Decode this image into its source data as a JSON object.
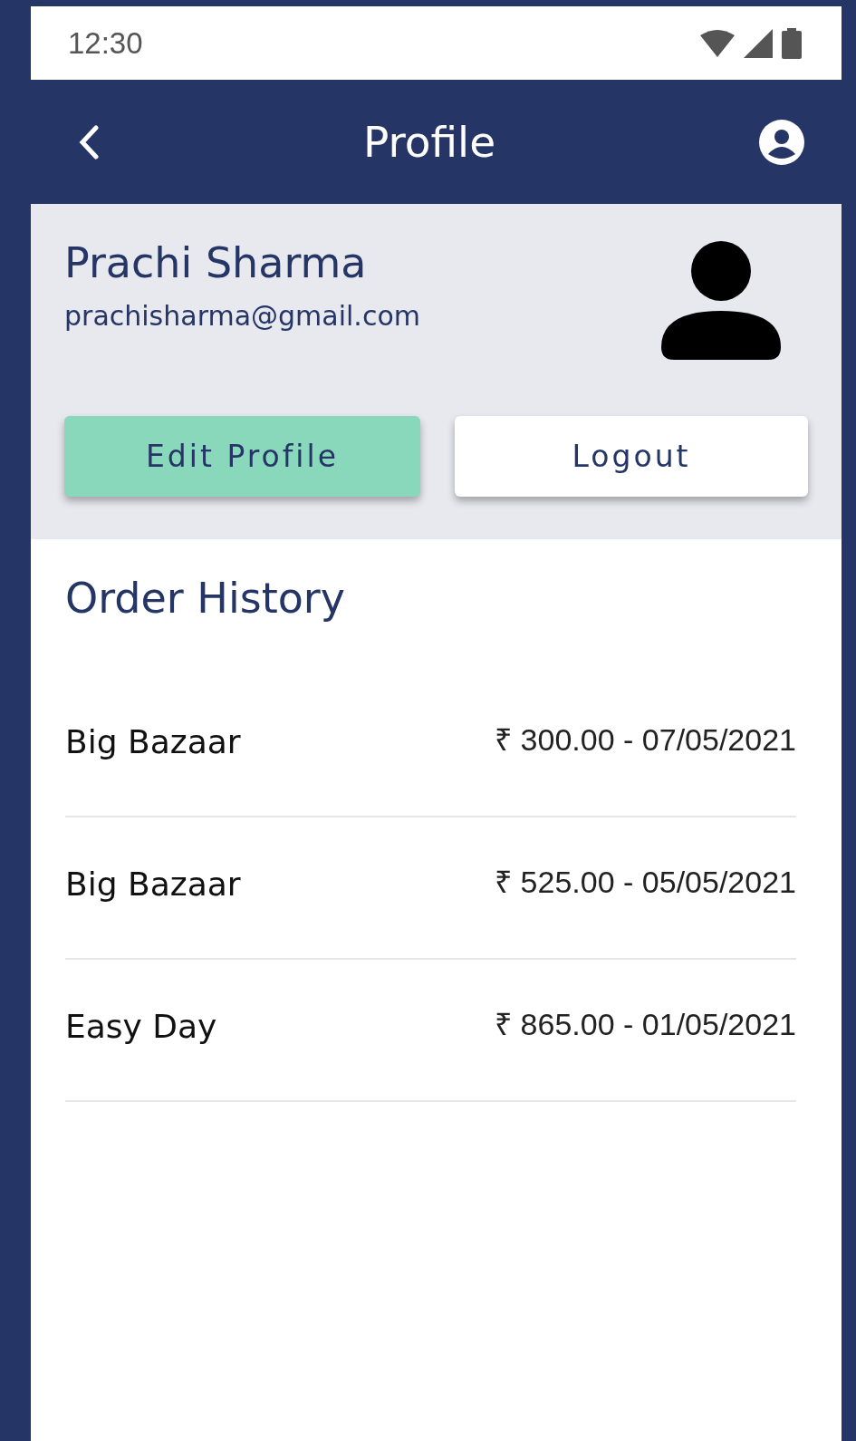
{
  "status_bar": {
    "time": "12:30"
  },
  "app_bar": {
    "title": "Profile"
  },
  "profile": {
    "name": "Prachi Sharma",
    "email": "prachisharma@gmail.com"
  },
  "buttons": [
    {
      "label": "Edit Profile",
      "kind": "primary"
    },
    {
      "label": "Logout",
      "kind": "secondary"
    }
  ],
  "order_history": {
    "title": "Order History",
    "orders": [
      {
        "store": "Big Bazaar",
        "amount": "₹ 300.00 - 07/05/2021"
      },
      {
        "store": "Big Bazaar",
        "amount": "₹ 525.00 - 05/05/2021"
      },
      {
        "store": "Easy Day",
        "amount": "₹ 865.00 - 01/05/2021"
      }
    ]
  }
}
